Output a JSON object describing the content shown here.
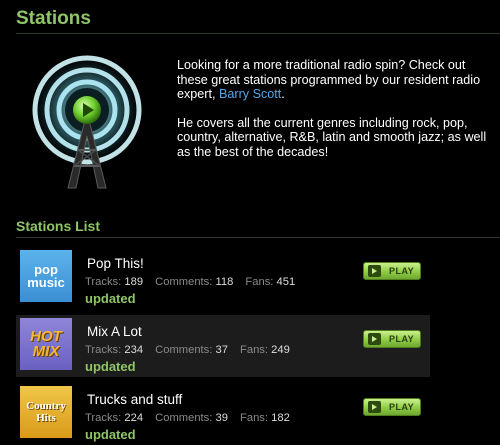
{
  "page": {
    "title": "Stations"
  },
  "intro": {
    "para1_before": "Looking for a more traditional radio spin? Check out these great stations programmed by our resident radio expert, ",
    "expert_link": "Barry Scott",
    "para1_after": ".",
    "para2": "He covers all the current genres including rock, pop, country, alternative, R&B, latin and smooth jazz; as well as the best of the decades!"
  },
  "list": {
    "title": "Stations List",
    "labels": {
      "tracks": "Tracks:",
      "comments": "Comments:",
      "fans": "Fans:"
    },
    "stations": [
      {
        "name": "Pop This!",
        "thumb_line1": "pop",
        "thumb_line2": "music",
        "tracks": "189",
        "comments": "118",
        "fans": "451",
        "status": "updated",
        "play_label": "PLAY"
      },
      {
        "name": "Mix A Lot",
        "thumb_line1": "HOT",
        "thumb_line2": "MIX",
        "tracks": "234",
        "comments": "37",
        "fans": "249",
        "status": "updated",
        "play_label": "PLAY"
      },
      {
        "name": "Trucks and stuff",
        "thumb_line1": "Country",
        "thumb_line2": "Hits",
        "tracks": "224",
        "comments": "39",
        "fans": "182",
        "status": "updated",
        "play_label": "PLAY"
      }
    ]
  },
  "colors": {
    "accent_green": "#8fc467",
    "link_blue": "#57a6e8",
    "background": "#000000"
  },
  "icons": {
    "hero": "radio-tower-icon",
    "play": "play-icon"
  }
}
